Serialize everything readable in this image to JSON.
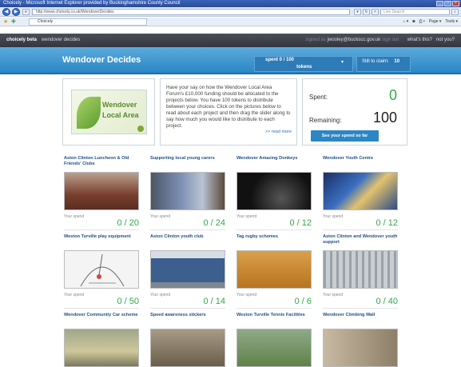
{
  "window": {
    "title": "Choicely - Microsoft Internet Explorer provided by Buckinghamshire County Council",
    "controls": [
      "_",
      "□",
      "×"
    ]
  },
  "browser": {
    "address": "http://www.choicely.co.uk/WendoverDecides",
    "search_placeholder": "Live Search",
    "tab_title": "Choicely",
    "commands": [
      "Page ▾",
      "Tools ▾"
    ]
  },
  "site_top": {
    "logo": "choicely beta",
    "link": "wendover decides",
    "signed_in_as": "signed as",
    "email": "jwooley@buckscc.gov.uk",
    "sign_out": "sign out",
    "whats_this": "what's this?",
    "not_you": "not you?"
  },
  "header": {
    "title": "Wendover Decides",
    "spent_label": "spent  0 / 100",
    "tokens_label": "tokens",
    "clear_label": "Still to claim:",
    "clear_value": "10"
  },
  "intro": {
    "logo_word1": "Wendover",
    "logo_word2": "Local Area",
    "text": "Have your say on how the Wendover Local Area Forum's £10,000 funding should be allocated to the projects below. You have 100 tokens to distribute between your choices. Click on the pictures below to read about each project and then drag the slider along to say how much you would like to distribute to each project.",
    "read_more": ">> read more"
  },
  "budget": {
    "spent_label": "Spent:",
    "spent_value": "0",
    "remaining_label": "Remaining:",
    "remaining_value": "100",
    "see_button": "See your spend so far"
  },
  "projects": [
    {
      "title": "Aston Clinton Luncheon & Old Friends' Clubs",
      "your_spend": "Your spend",
      "value": "0 / 20",
      "bg": "#7a3f2e"
    },
    {
      "title": "Supporting local young carers",
      "your_spend": "Your spend",
      "value": "0 / 24",
      "bg": "#6f7f9a"
    },
    {
      "title": "Wendover Amazing Donkeys",
      "your_spend": "Your spend",
      "value": "0 / 12",
      "bg": "#111111"
    },
    {
      "title": "Wendover Youth Centre",
      "your_spend": "Your spend",
      "value": "0 / 12",
      "bg": "#2a4e88"
    },
    {
      "title": "Weston Turville play equipment",
      "your_spend": "Your spend",
      "value": "0 / 50",
      "bg": "#f4f4f4"
    },
    {
      "title": "Aston Clinton youth club",
      "your_spend": "Your spend",
      "value": "0 / 14",
      "bg": "#3b5f8e"
    },
    {
      "title": "Tag rugby schemes",
      "your_spend": "Your spend",
      "value": "0 / 6",
      "bg": "#c9882a"
    },
    {
      "title": "Aston Clinton and Wendover youth support",
      "your_spend": "Your spend",
      "value": "0 / 40",
      "bg": "#8a9098"
    },
    {
      "title": "Wendover Community Car scheme",
      "your_spend": "",
      "value": "",
      "bg": "#b8b07a"
    },
    {
      "title": "Speed awareness stickers",
      "your_spend": "",
      "value": "",
      "bg": "#7b6d5a"
    },
    {
      "title": "Weston Turville Tennis Facilities",
      "your_spend": "",
      "value": "",
      "bg": "#6a8a52"
    },
    {
      "title": "Wendover Climbing Wall",
      "your_spend": "",
      "value": "",
      "bg": "#a89a86"
    }
  ],
  "colors": {
    "accent": "#2a86c4",
    "positive": "#34a84b",
    "title_link": "#1f4f86"
  }
}
